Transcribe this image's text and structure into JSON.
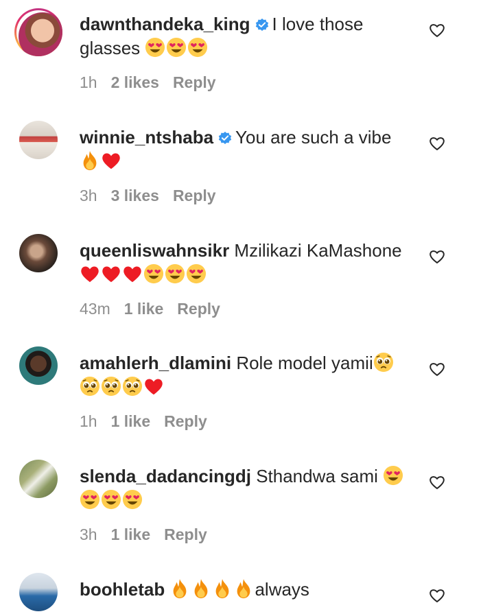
{
  "colors": {
    "text": "#262626",
    "meta": "#8e8e8e",
    "verified": "#3897f0",
    "heart": "#ed1c24"
  },
  "comments": [
    {
      "username": "dawnthandeka_king",
      "verified": true,
      "story_ring": true,
      "text": "I love those glasses",
      "emojis": [
        "heart-eyes",
        "heart-eyes",
        "heart-eyes"
      ],
      "time": "1h",
      "likes": "2 likes",
      "reply": "Reply"
    },
    {
      "username": "winnie_ntshaba",
      "verified": true,
      "text": "You are such a vibe",
      "emojis": [
        "fire",
        "red-heart"
      ],
      "time": "3h",
      "likes": "3 likes",
      "reply": "Reply"
    },
    {
      "username": "queenliswahnsikr",
      "verified": false,
      "text": "Mzilikazi KaMashone",
      "emojis": [
        "red-heart",
        "red-heart",
        "red-heart",
        "heart-eyes",
        "heart-eyes",
        "heart-eyes"
      ],
      "time": "43m",
      "likes": "1 like",
      "reply": "Reply"
    },
    {
      "username": "amahlerh_dlamini",
      "verified": false,
      "text": "Role model yamii",
      "emojis": [
        "pleading",
        "pleading",
        "pleading",
        "pleading",
        "red-heart"
      ],
      "time": "1h",
      "likes": "1 like",
      "reply": "Reply"
    },
    {
      "username": "slenda_dadancingdj",
      "verified": false,
      "text": "Sthandwa sami",
      "emojis": [
        "heart-eyes",
        "heart-eyes",
        "heart-eyes",
        "heart-eyes"
      ],
      "time": "3h",
      "likes": "1 like",
      "reply": "Reply"
    },
    {
      "username": "boohletab",
      "verified": false,
      "text": "always",
      "emojis_before_text": [
        "fire",
        "fire",
        "fire",
        "fire"
      ]
    }
  ]
}
